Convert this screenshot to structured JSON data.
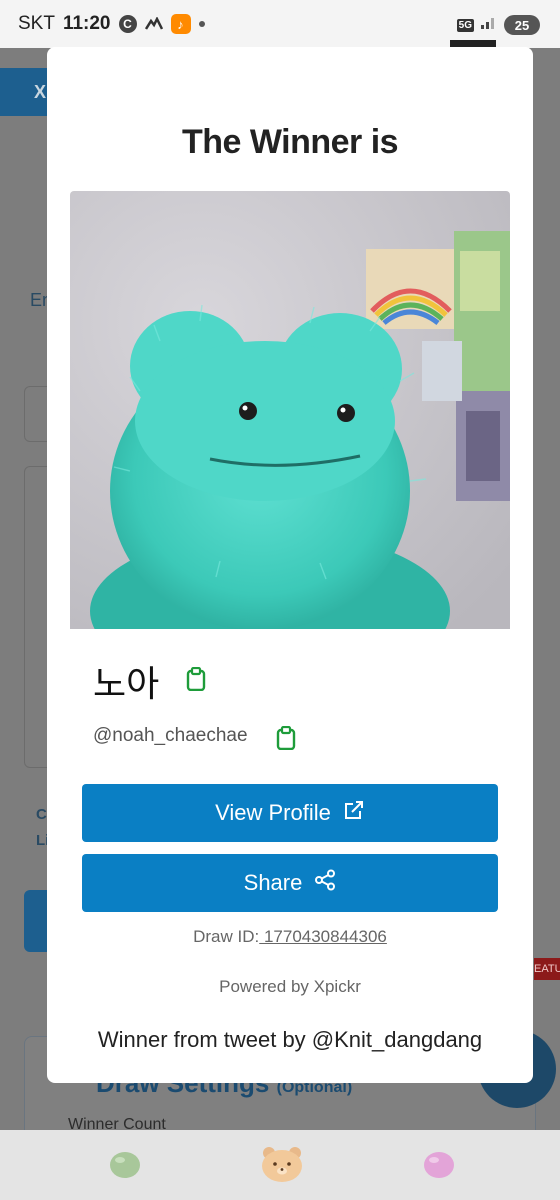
{
  "status_bar": {
    "carrier": "SKT",
    "time": "11:20",
    "icon_c": "C",
    "network": "5G",
    "battery": "25"
  },
  "background": {
    "header_label": "X",
    "text_en": "En",
    "settings_title": "Draw Settings",
    "settings_optional": "(Optional)",
    "winner_count_label": "Winner Count",
    "feature_label": "EATU",
    "side_text_1": "C",
    "side_text_2": "Li"
  },
  "modal": {
    "title": "The Winner is",
    "winner_name": "노아",
    "winner_handle": "@noah_chaechae",
    "view_profile_label": "View Profile",
    "share_label": "Share",
    "draw_id_label": "Draw ID:",
    "draw_id_value": " 1770430844306",
    "powered_by": "Powered by Xpickr",
    "tweet_line": "Winner from tweet by @Knit_dangdang"
  },
  "colors": {
    "primary_button": "#0a7fc4",
    "copy_icon": "#1e9c3a",
    "photo_toy": "#3fcfbf"
  },
  "icons": {
    "copy": "clipboard-icon",
    "external": "external-link-icon",
    "share": "share-icon",
    "nav_left": "green-bean-icon",
    "nav_center": "bear-face-icon",
    "nav_right": "pink-bean-icon"
  }
}
